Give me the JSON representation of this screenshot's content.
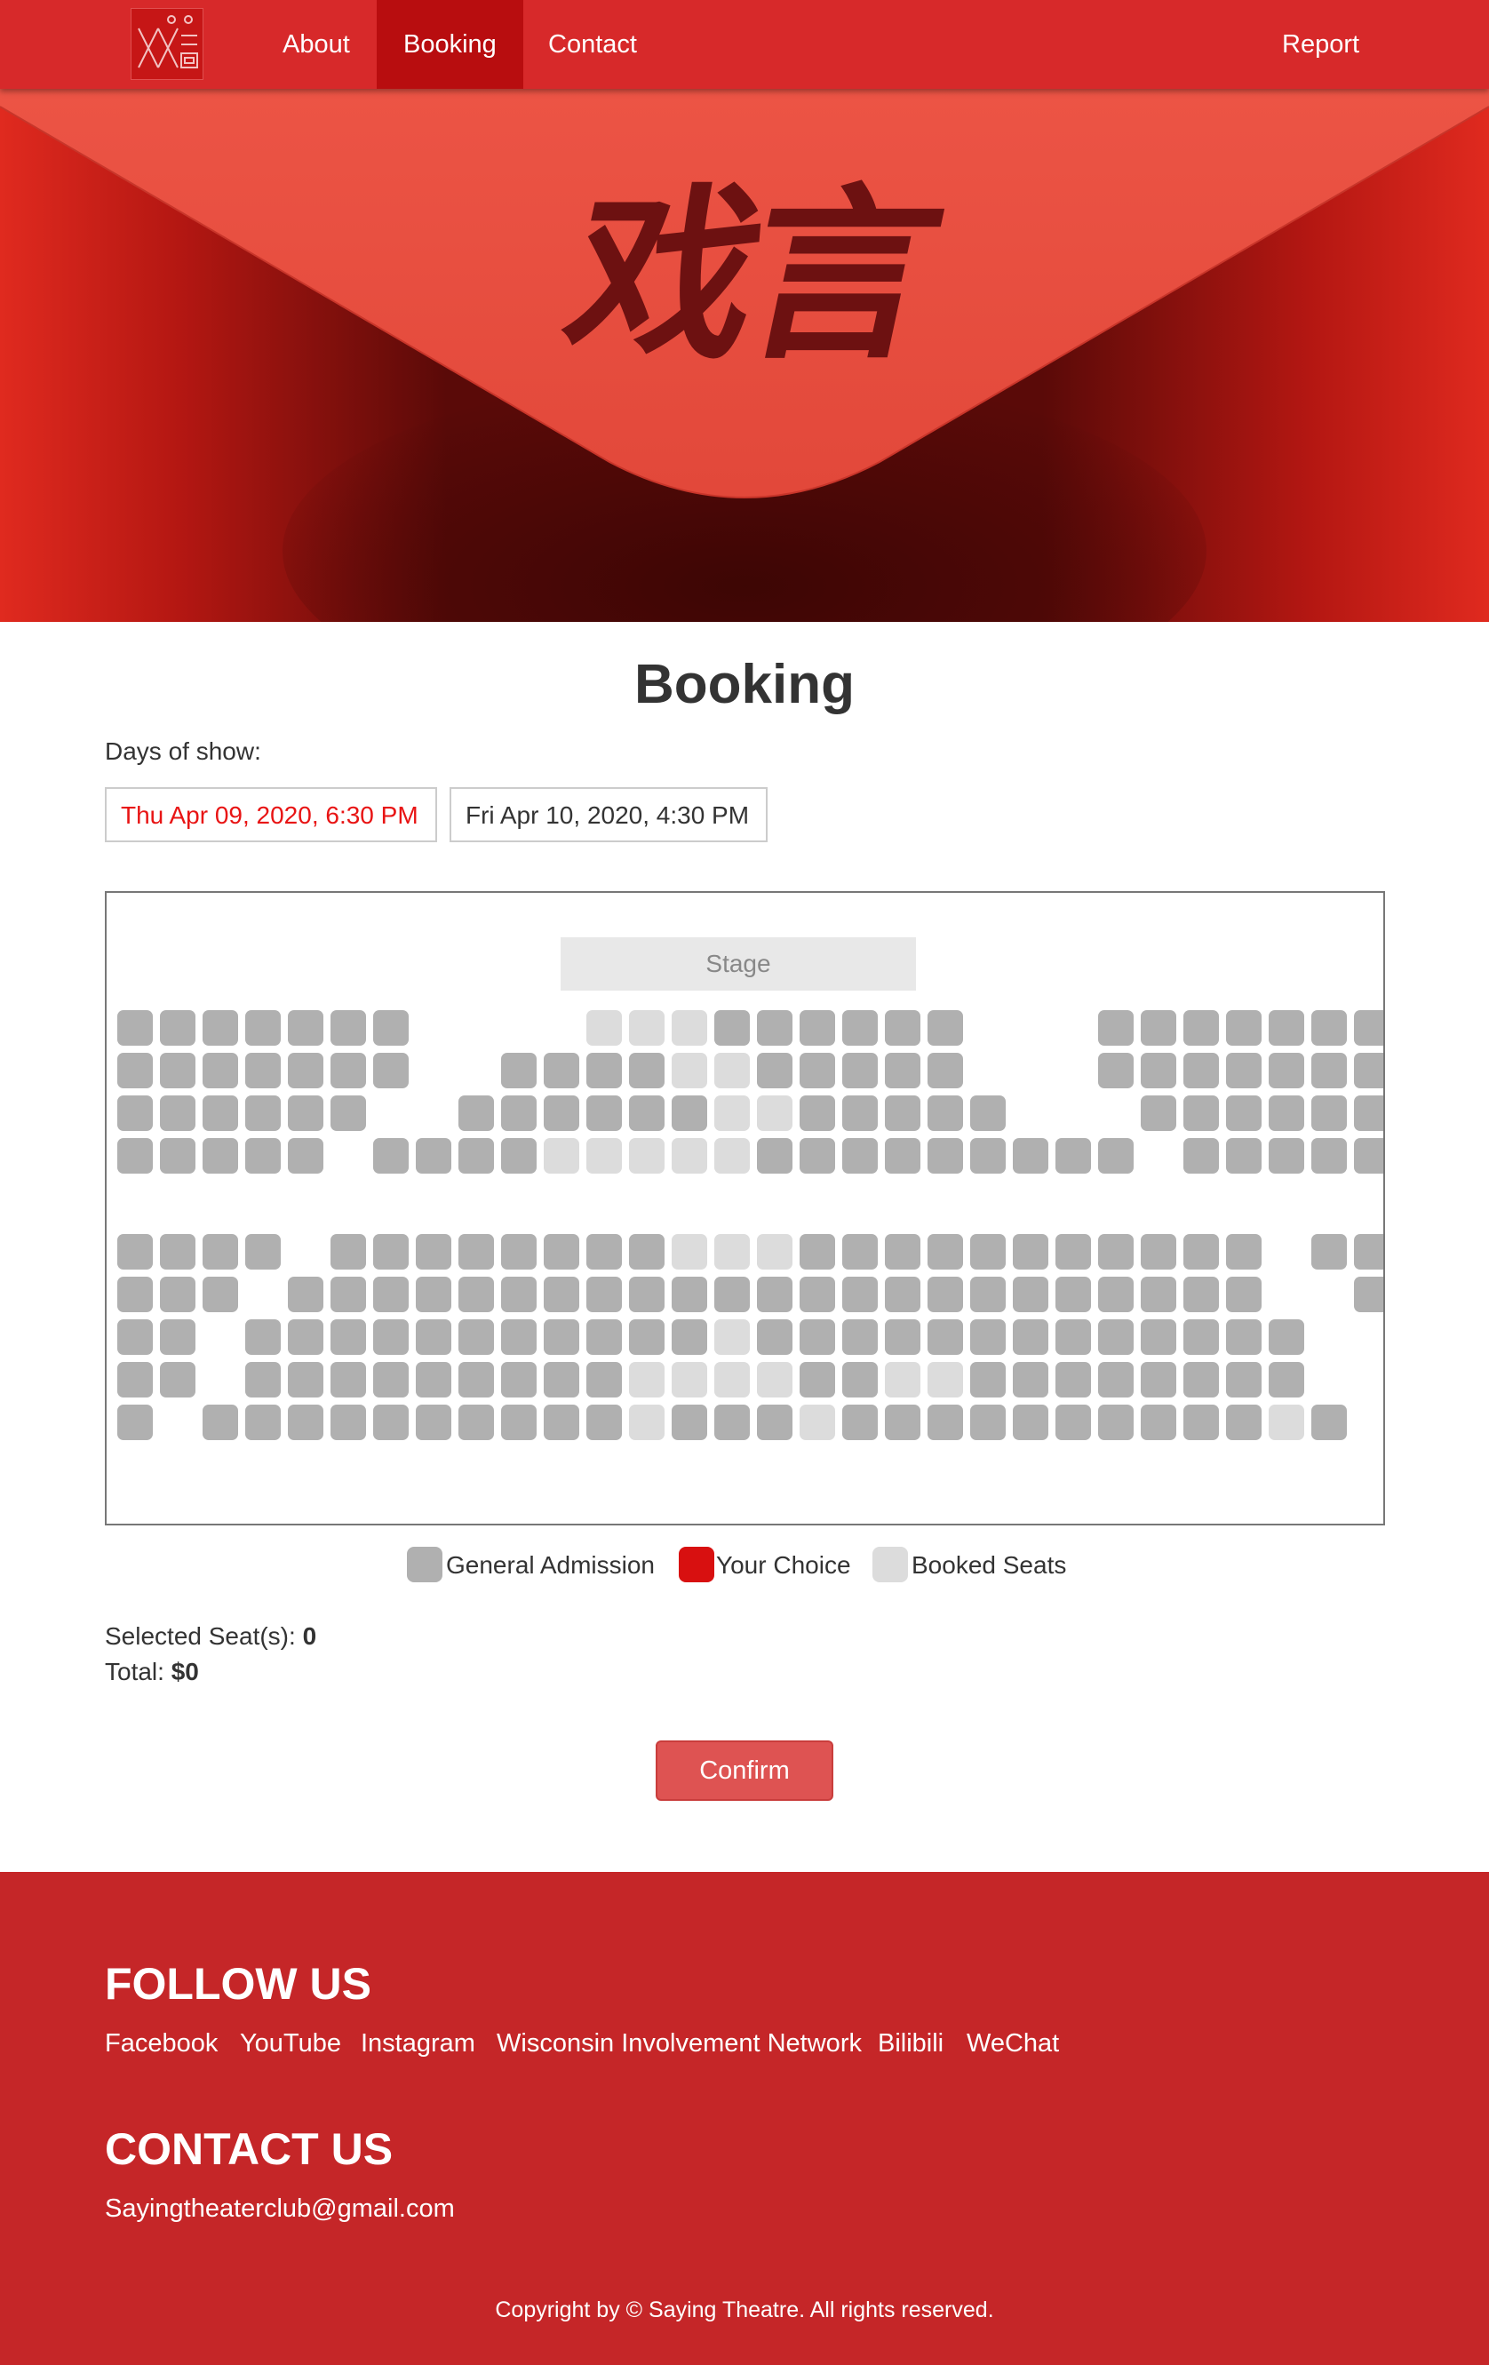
{
  "nav": {
    "logo_alt": "Saying Theatre logo",
    "links": [
      {
        "label": "About",
        "active": false
      },
      {
        "label": "Booking",
        "active": true
      },
      {
        "label": "Contact",
        "active": false
      }
    ],
    "report_label": "Report"
  },
  "hero": {
    "calligraphy": "戏言"
  },
  "booking": {
    "title": "Booking",
    "days_label": "Days of show:",
    "days": [
      {
        "label": "Thu Apr 09, 2020, 6:30 PM",
        "selected": true
      },
      {
        "label": "Fri Apr 10, 2020, 4:30 PM",
        "selected": false
      }
    ],
    "stage_label": "Stage",
    "legend": [
      {
        "label": "General Admission",
        "color": "#b0b0b0"
      },
      {
        "label": "Your Choice",
        "color": "#d81010"
      },
      {
        "label": "Booked Seats",
        "color": "#dcdcdc"
      }
    ],
    "selected_label": "Selected Seat(s):",
    "selected_count": "0",
    "total_label": "Total:",
    "total_value": "$0",
    "confirm_label": "Confirm"
  },
  "seatmap": {
    "rows": [
      {
        "seats": "GGGGGGG____BBBGGGGGG___GGGGGGG"
      },
      {
        "seats": "GGGGGGG__GGGGBBGGGGG___GGGGGGG"
      },
      {
        "seats": "GGGGGG__GGGGGGBBGGGGG___GGGGGG"
      },
      {
        "seats": "GGGGG_GGGGBBBBBGGGGGGGGG_GGGGG"
      },
      {
        "seats": "GGGG_GGGGGGGGBBBGGGGGGGGGGG_GG"
      },
      {
        "seats": "GGG_GGGGGGGGGGGGGGGGGGGGGGG__G"
      },
      {
        "seats": "GG_GGGGGGGGGGGBGGGGGGGGGGGGG__"
      },
      {
        "seats": "GG_GGGGGGGGGBBBBGGBBGGGGGGGG__"
      },
      {
        "seats": "G_GGGGGGGGGGBGGGBGGGGGGGGGGBG_"
      }
    ]
  },
  "footer": {
    "follow_title": "FOLLOW US",
    "links": [
      "Facebook",
      "YouTube",
      "Instagram",
      "Wisconsin Involvement Network",
      "Bilibili",
      "WeChat"
    ],
    "contact_title": "CONTACT US",
    "email": "Sayingtheaterclub@gmail.com",
    "copyright": "Copyright by © Saying Theatre. All rights reserved."
  }
}
